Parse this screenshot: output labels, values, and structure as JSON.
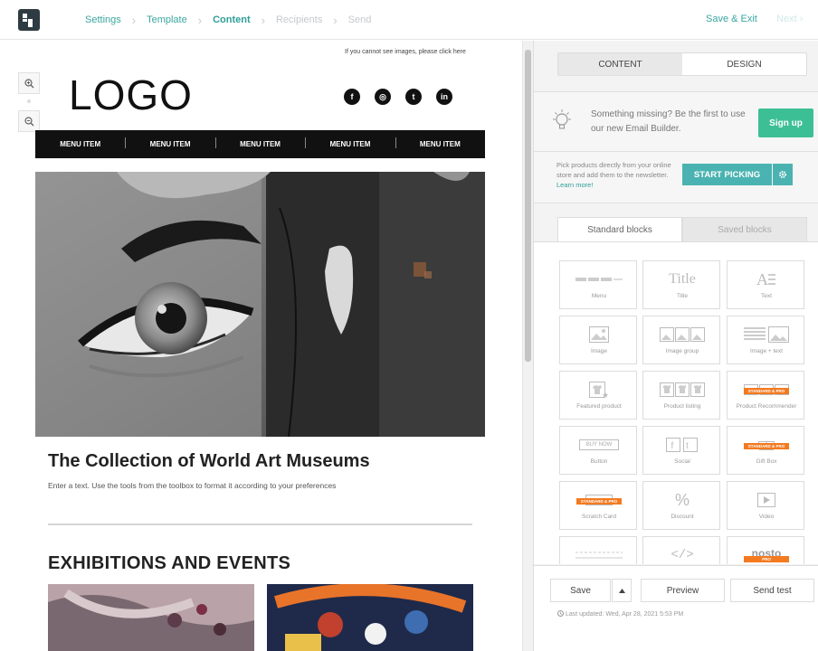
{
  "nav": {
    "steps": [
      "Settings",
      "Template",
      "Content",
      "Recipients",
      "Send"
    ],
    "sep": "›",
    "save_exit": "Save & Exit",
    "next": "Next"
  },
  "email": {
    "cant_see": "If you cannot see images, please click here",
    "logo": "LOGO",
    "social": [
      "f",
      "◎",
      "t",
      "in"
    ],
    "menu": [
      "MENU ITEM",
      "MENU ITEM",
      "MENU ITEM",
      "MENU ITEM",
      "MENU ITEM"
    ],
    "title": "The Collection of World Art Museums",
    "body": "Enter a text. Use the tools from the toolbox to format it according to your preferences",
    "section_title": "EXHIBITIONS AND EVENTS"
  },
  "panel": {
    "tab_content": "CONTENT",
    "tab_design": "DESIGN",
    "promo": "Something missing? Be the first to use our new Email Builder.",
    "signup": "Sign up",
    "pick_text": "Pick products directly from your online store and add them to the newsletter.",
    "learn_more": "Learn more!",
    "start_picking": "START PICKING",
    "standard_blocks": "Standard blocks",
    "saved_blocks": "Saved blocks",
    "badge": "STANDARD & PRO",
    "badge_pro": "PRO",
    "blocks": [
      "Menu",
      "Title",
      "Text",
      "Image",
      "Image group",
      "Image + text",
      "Featured product",
      "Product listing",
      "Product Recommender",
      "Button",
      "Social",
      "Gift Box",
      "Scratch Card",
      "Discount",
      "Video"
    ],
    "title_glyph": "Title",
    "buy_now": "BUY NOW",
    "percent": "%",
    "code": "</>",
    "nosto": "nosto",
    "save": "Save",
    "preview": "Preview",
    "send_test": "Send test",
    "last_updated": "Last updated:  Wed, Apr 28, 2021 5:53 PM"
  },
  "colors": {
    "accent": "#3aa6a0",
    "signup": "#3dbf95",
    "pick": "#4ab3b1",
    "badge": "#f47a20"
  }
}
